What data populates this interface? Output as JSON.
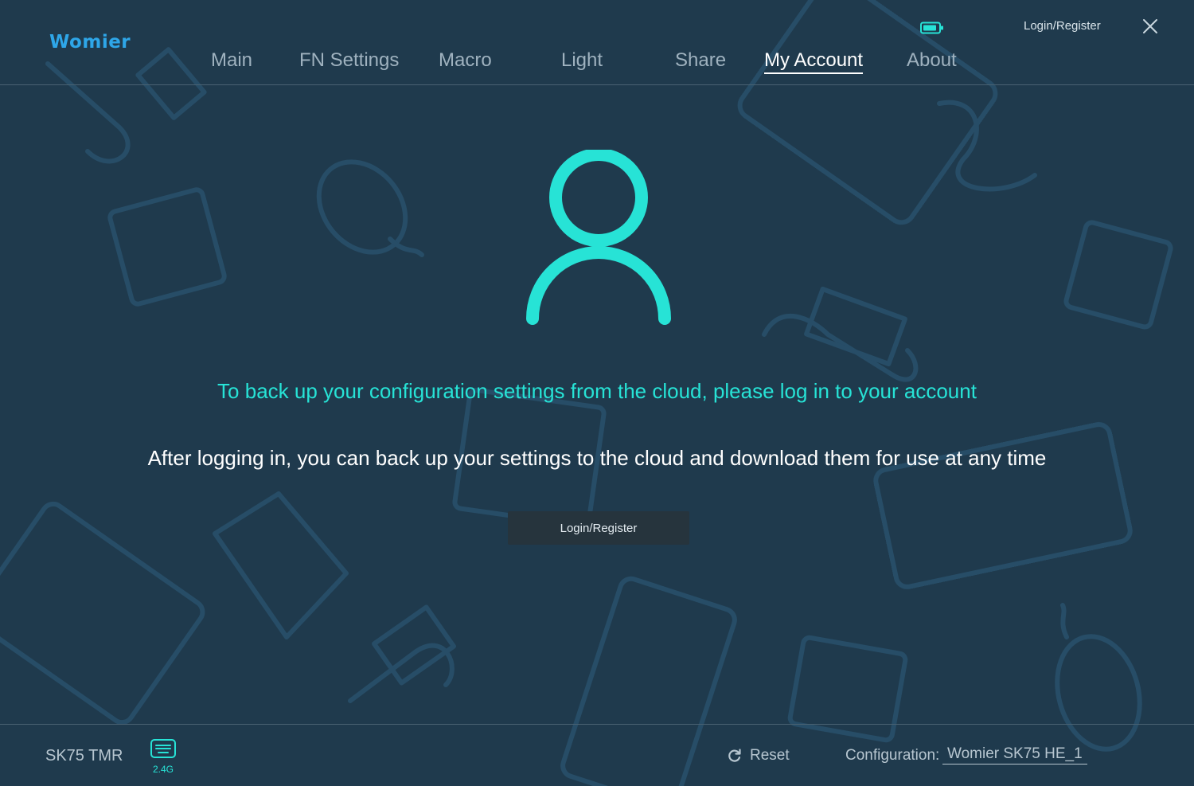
{
  "app": {
    "logo": "Womier"
  },
  "header": {
    "tabs": [
      {
        "label": "Main"
      },
      {
        "label": "FN Settings"
      },
      {
        "label": "Macro"
      },
      {
        "label": "Light"
      },
      {
        "label": "Share"
      },
      {
        "label": "My Account",
        "active": true
      },
      {
        "label": "About"
      }
    ],
    "login_link": "Login/Register",
    "icons": [
      "battery-icon",
      "close-icon"
    ]
  },
  "main": {
    "headline": "To back up your configuration settings from the cloud, please log in to your account",
    "subline": "After logging in, you can back up your settings to the cloud and download them for use at any time",
    "login_button": "Login/Register",
    "icon": "user-icon"
  },
  "footer": {
    "device_name": "SK75 TMR",
    "connection": "2.4G",
    "reset_label": "Reset",
    "config_label": "Configuration:",
    "config_value": "Womier SK75 HE_1"
  },
  "colors": {
    "background": "#1f3a4d",
    "accent": "#27e3d6",
    "logo": "#2ea6e8",
    "button_bg": "#26343d"
  }
}
